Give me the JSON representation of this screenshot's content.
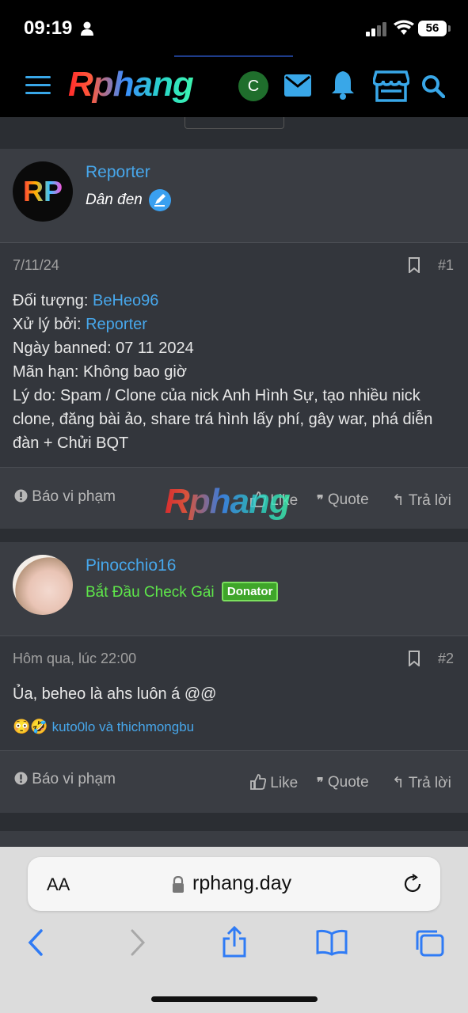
{
  "status_bar": {
    "time": "09:19",
    "battery": "56"
  },
  "header": {
    "logo": "Rphang",
    "avatar_letter": "C"
  },
  "watermark": "Rphang",
  "posts": [
    {
      "username": "Reporter",
      "user_title": "Dân đen",
      "avatar_text": "RP",
      "date": "7/11/24",
      "number": "#1",
      "lines": [
        {
          "label": "Đối tượng: ",
          "value": "BeHeo96"
        },
        {
          "label": "Xử lý bởi: ",
          "value": "Reporter"
        },
        {
          "label": "Ngày banned: 07 11 2024"
        },
        {
          "label": "Mãn hạn: Không bao giờ"
        },
        {
          "label": "Lý do: Spam / Clone của nick Anh Hình Sự, tạo nhiều nick clone, đăng bài ảo, share trá hình lấy phí, gây war, phá diễn đàn + Chửi BQT"
        }
      ],
      "actions": {
        "report": "Báo vi phạm",
        "like": "Like",
        "quote": "Quote",
        "reply": "Trả lời"
      }
    },
    {
      "username": "Pinocchio16",
      "user_title": "Bắt Đầu Check Gái",
      "badge": "Donator",
      "date": "Hôm qua, lúc 22:00",
      "number": "#2",
      "message": "Ủa, beheo là ahs luôn á @@",
      "reactions_emoji": "😳🤣",
      "reactions_users": "kuto0lo và thichmongbu",
      "actions": {
        "report": "Báo vi phạm",
        "like": "Like",
        "quote": "Quote",
        "reply": "Trả lời"
      }
    }
  ],
  "browser": {
    "text_size_label": "AA",
    "url": "rphang.day"
  },
  "colors": {
    "link": "#47a7eb",
    "title_green": "#5ee64a",
    "donator_bg": "#3fa52a"
  }
}
